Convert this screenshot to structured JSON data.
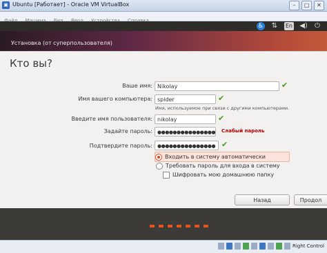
{
  "window": {
    "title": "Ubuntu [Работает] - Oracle VM VirtualBox",
    "controls": [
      "–",
      "□",
      "✕"
    ]
  },
  "menubar": {
    "items": [
      "Файл",
      "Машина",
      "Вид",
      "Ввод",
      "Устройства",
      "Справка"
    ]
  },
  "panel": {
    "language": "En"
  },
  "installer": {
    "step_title": "Установка (от суперпользователя)",
    "heading": "Кто вы?",
    "labels": {
      "name": "Ваше имя:",
      "computer": "Имя вашего компьютера:",
      "username": "Введите имя пользователя:",
      "password": "Задайте пароль:",
      "confirm": "Подтвердите пароль:"
    },
    "values": {
      "name": "Nikolay",
      "computer": "spider",
      "username": "nikolay",
      "password": "●●●●●●●●●●●●●●●",
      "confirm": "●●●●●●●●●●●●●●●"
    },
    "computer_hint": "Имя, используемое при связи с другими компьютерами.",
    "password_strength": "Слабый пароль",
    "options": {
      "auto_login": "Входить в систему автоматически",
      "require_password": "Требовать пароль для входа в систему",
      "encrypt_home": "Шифровать мою домашнюю папку"
    },
    "buttons": {
      "back": "Назад",
      "next": "Продол"
    }
  },
  "statusbar": {
    "host_key": "Right Control"
  },
  "colors": {
    "accent": "#e95420",
    "check": "#4a9a1a",
    "weak": "#b00000"
  }
}
